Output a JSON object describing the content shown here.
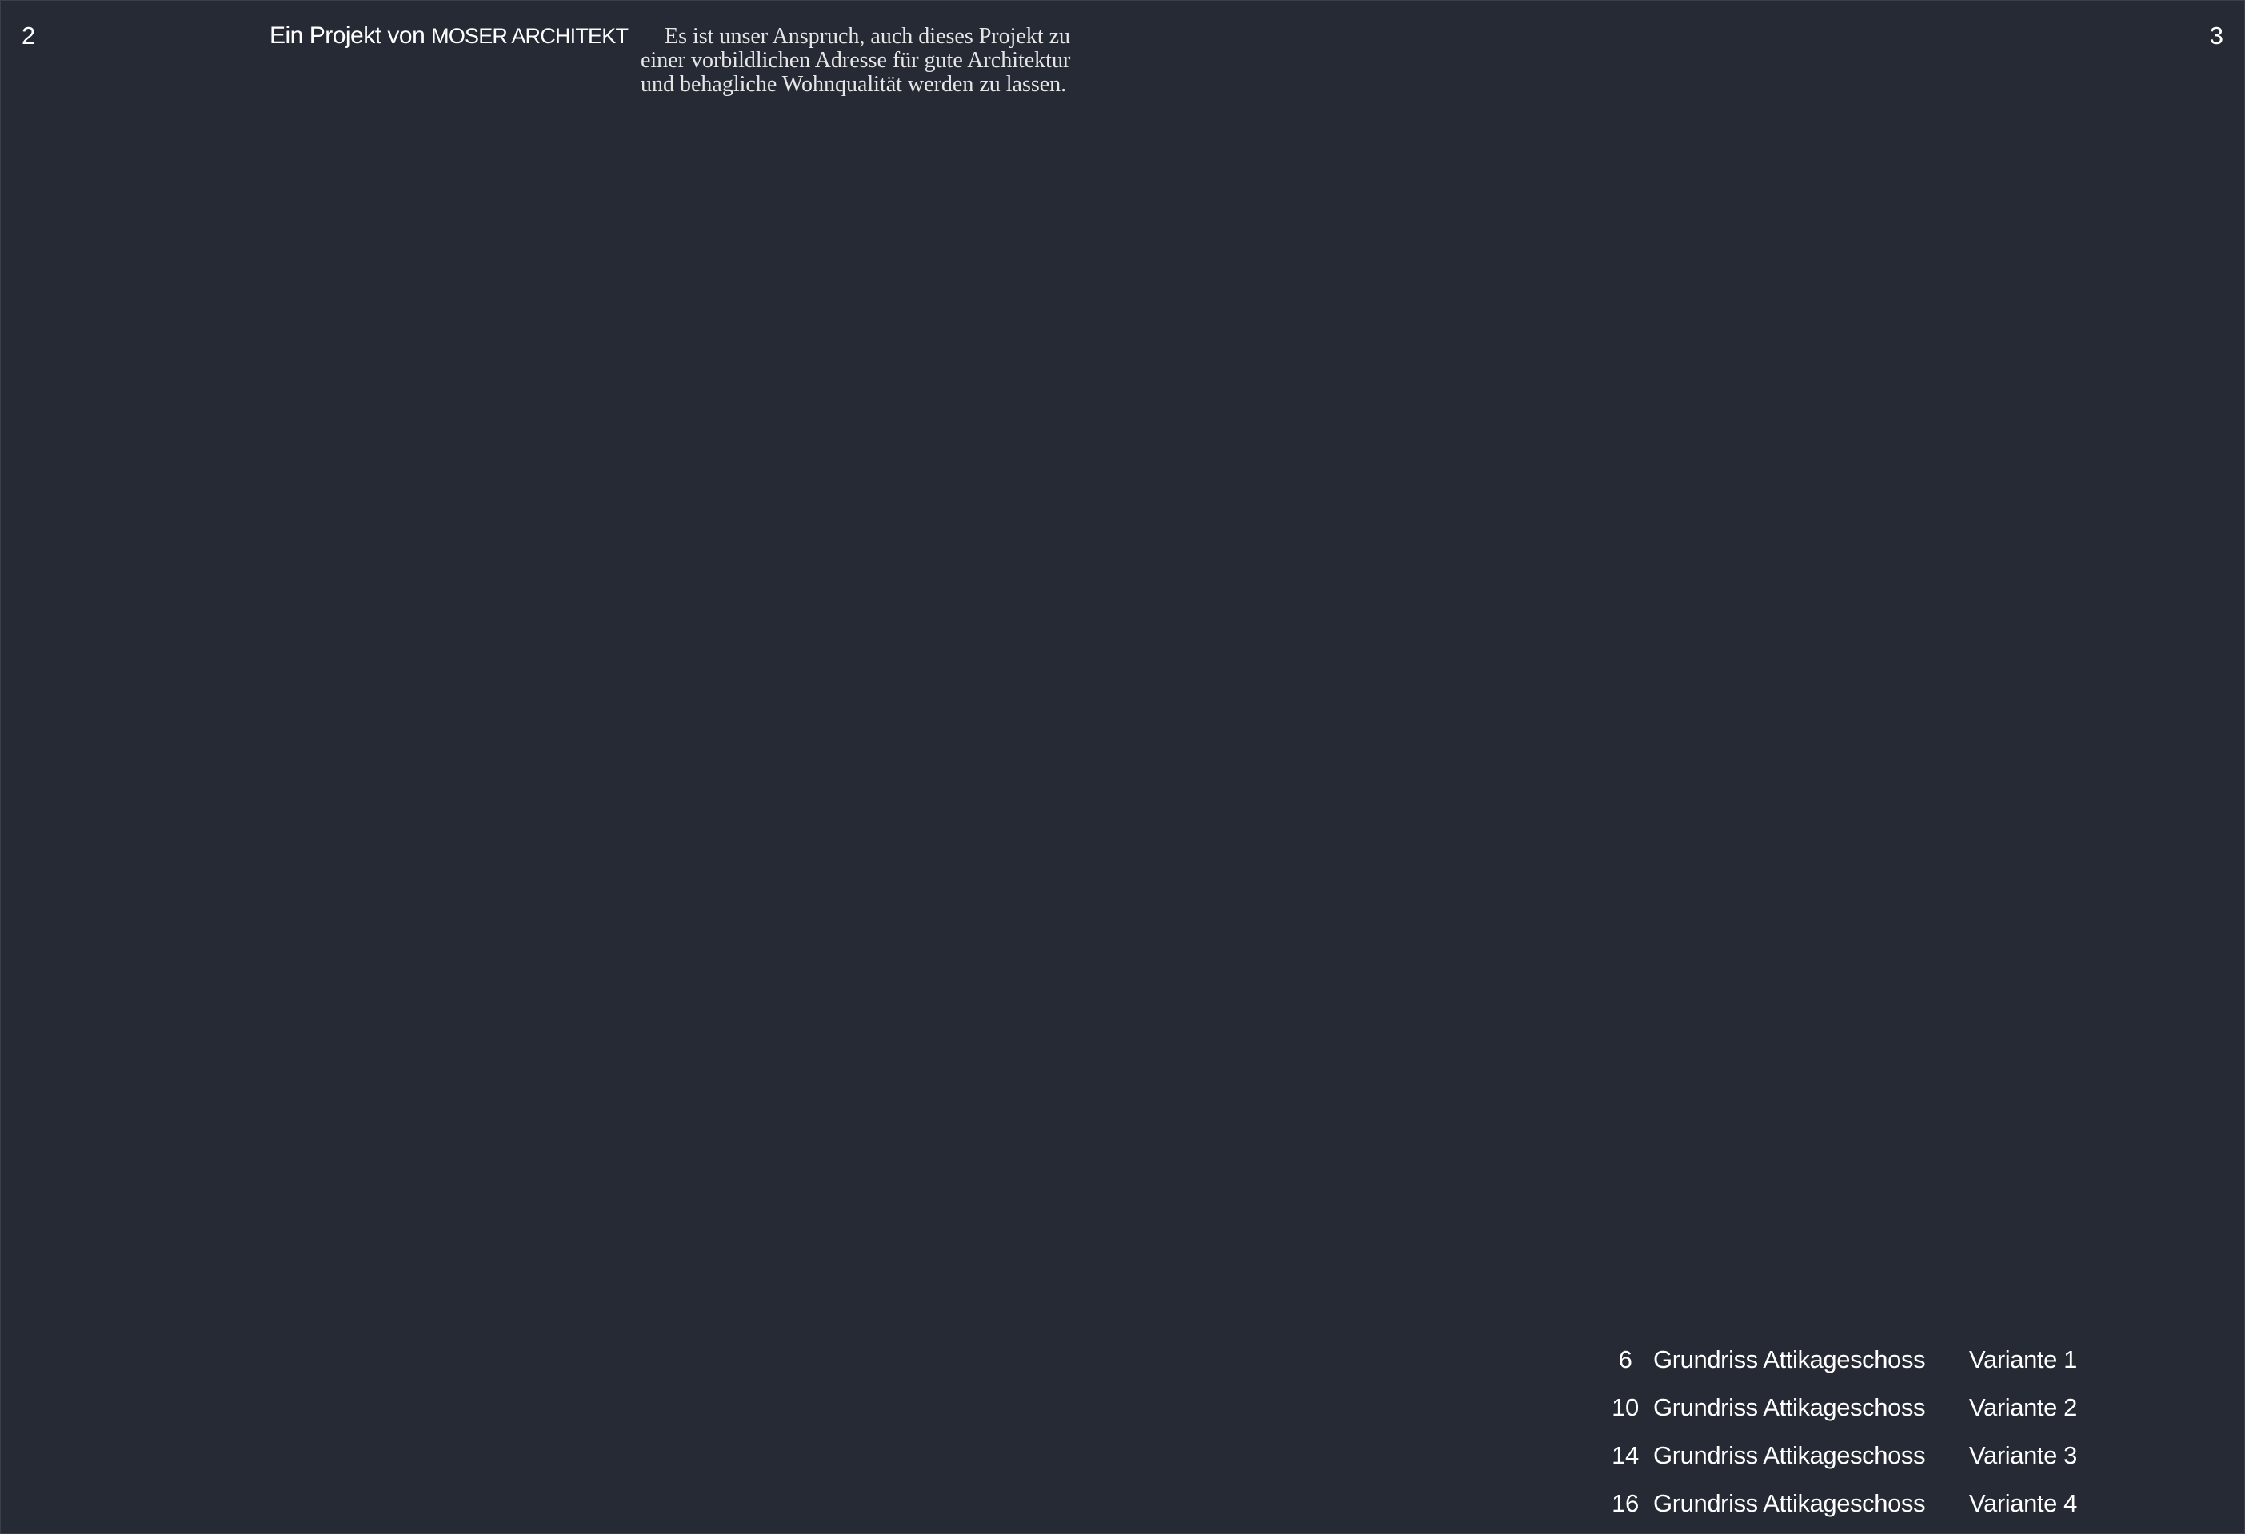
{
  "left_page": {
    "page_number": "2",
    "credit": {
      "prefix": "Ein Projekt von",
      "firm": "MOSER ARCHITEKT"
    },
    "intro_text": "Es ist unser Anspruch, auch dieses Projekt zu einer vorbildlichen Adresse für gute Architektur und behagliche Wohnqualität werden zu lassen."
  },
  "right_page": {
    "page_number": "3",
    "toc": [
      {
        "page": "6",
        "title": "Grundriss Attikageschoss",
        "variant": "Variante 1"
      },
      {
        "page": "10",
        "title": "Grundriss Attikageschoss",
        "variant": "Variante 2"
      },
      {
        "page": "14",
        "title": "Grundriss Attikageschoss",
        "variant": "Variante 3"
      },
      {
        "page": "16",
        "title": "Grundriss Attikageschoss",
        "variant": "Variante 4"
      }
    ]
  }
}
